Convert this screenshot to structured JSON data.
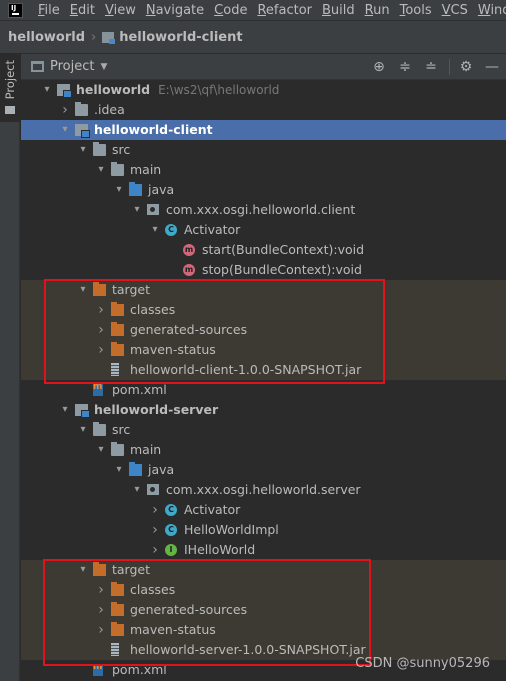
{
  "menu": [
    "File",
    "Edit",
    "View",
    "Navigate",
    "Code",
    "Refactor",
    "Build",
    "Run",
    "Tools",
    "VCS",
    "Windo"
  ],
  "breadcrumb": [
    "helloworld",
    "helloworld-client"
  ],
  "side_tab": "Project",
  "toolwindow": {
    "title": "Project"
  },
  "tree": [
    {
      "level": 0,
      "arrow": "down",
      "icon": "module",
      "label": "helloworld",
      "path": "E:\\ws2\\qf\\helloworld",
      "bold": true
    },
    {
      "level": 1,
      "arrow": "right",
      "icon": "folder-grey",
      "label": ".idea"
    },
    {
      "level": 1,
      "arrow": "down",
      "icon": "module",
      "label": "helloworld-client",
      "bold": true,
      "selected": true
    },
    {
      "level": 2,
      "arrow": "down",
      "icon": "folder-grey",
      "label": "src"
    },
    {
      "level": 3,
      "arrow": "down",
      "icon": "folder-grey",
      "label": "main"
    },
    {
      "level": 4,
      "arrow": "down",
      "icon": "folder-blue",
      "label": "java"
    },
    {
      "level": 5,
      "arrow": "down",
      "icon": "pkg",
      "label": "com.xxx.osgi.helloworld.client"
    },
    {
      "level": 6,
      "arrow": "down",
      "icon": "cls",
      "label": "Activator"
    },
    {
      "level": 7,
      "arrow": "none",
      "icon": "meth",
      "label": "start(BundleContext):void"
    },
    {
      "level": 7,
      "arrow": "none",
      "icon": "meth",
      "label": "stop(BundleContext):void"
    },
    {
      "level": 2,
      "arrow": "down",
      "icon": "folder-orange",
      "label": "target",
      "excluded": true
    },
    {
      "level": 3,
      "arrow": "right",
      "icon": "folder-orange",
      "label": "classes",
      "excluded": true
    },
    {
      "level": 3,
      "arrow": "right",
      "icon": "folder-orange",
      "label": "generated-sources",
      "excluded": true
    },
    {
      "level": 3,
      "arrow": "right",
      "icon": "folder-orange",
      "label": "maven-status",
      "excluded": true
    },
    {
      "level": 3,
      "arrow": "none",
      "icon": "jar",
      "label": "helloworld-client-1.0.0-SNAPSHOT.jar",
      "excluded": true
    },
    {
      "level": 2,
      "arrow": "none",
      "icon": "xml",
      "label": "pom.xml"
    },
    {
      "level": 1,
      "arrow": "down",
      "icon": "module",
      "label": "helloworld-server",
      "bold": true
    },
    {
      "level": 2,
      "arrow": "down",
      "icon": "folder-grey",
      "label": "src"
    },
    {
      "level": 3,
      "arrow": "down",
      "icon": "folder-grey",
      "label": "main"
    },
    {
      "level": 4,
      "arrow": "down",
      "icon": "folder-blue",
      "label": "java"
    },
    {
      "level": 5,
      "arrow": "down",
      "icon": "pkg",
      "label": "com.xxx.osgi.helloworld.server"
    },
    {
      "level": 6,
      "arrow": "right",
      "icon": "cls",
      "label": "Activator"
    },
    {
      "level": 6,
      "arrow": "right",
      "icon": "cls",
      "label": "HelloWorldImpl"
    },
    {
      "level": 6,
      "arrow": "right",
      "icon": "intf",
      "label": "IHelloWorld"
    },
    {
      "level": 2,
      "arrow": "down",
      "icon": "folder-orange",
      "label": "target",
      "excluded": true
    },
    {
      "level": 3,
      "arrow": "right",
      "icon": "folder-orange",
      "label": "classes",
      "excluded": true
    },
    {
      "level": 3,
      "arrow": "right",
      "icon": "folder-orange",
      "label": "generated-sources",
      "excluded": true
    },
    {
      "level": 3,
      "arrow": "right",
      "icon": "folder-orange",
      "label": "maven-status",
      "excluded": true
    },
    {
      "level": 3,
      "arrow": "none",
      "icon": "jar",
      "label": "helloworld-server-1.0.0-SNAPSHOT.jar",
      "excluded": true
    },
    {
      "level": 2,
      "arrow": "none",
      "icon": "xml",
      "label": "pom.xml"
    }
  ],
  "watermark": "CSDN @sunny05296",
  "colors": {
    "selection": "#4a6ea9",
    "excluded_bg": "#3d3a33",
    "annotation_box": "#e0121c",
    "target_folder": "#c46d2b"
  }
}
